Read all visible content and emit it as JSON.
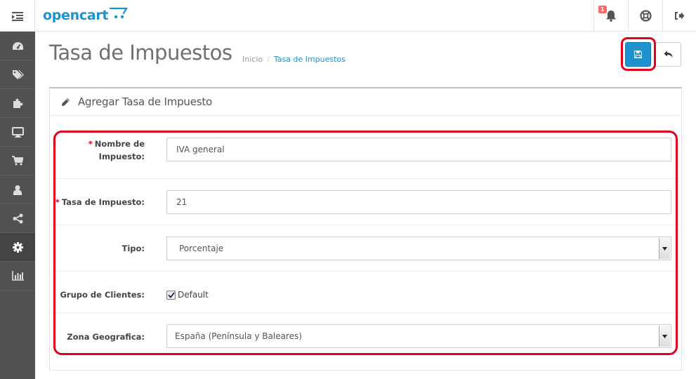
{
  "header": {
    "logo_text": "opencart",
    "notifications_count": "1"
  },
  "sidebar": {
    "items": [
      {
        "icon": "dashboard-icon"
      },
      {
        "icon": "tags-icon"
      },
      {
        "icon": "puzzle-icon"
      },
      {
        "icon": "desktop-icon"
      },
      {
        "icon": "shopping-cart-icon"
      },
      {
        "icon": "user-icon"
      },
      {
        "icon": "share-icon"
      },
      {
        "icon": "cog-icon",
        "active": true
      },
      {
        "icon": "bar-chart-icon"
      }
    ]
  },
  "page": {
    "title": "Tasa de Impuestos",
    "breadcrumb": [
      "Inicio",
      "Tasa de Impuestos"
    ],
    "breadcrumb_sep": "/"
  },
  "panel": {
    "title": "Agregar Tasa de Impuesto"
  },
  "form": {
    "name_label_line1": "Nombre de",
    "name_label_line2": "Impuesto:",
    "name_value": "IVA general",
    "rate_label": "Tasa de Impuesto:",
    "rate_value": "21",
    "type_label": "Tipo:",
    "type_value": "Porcentaje",
    "group_label": "Grupo de Clientes:",
    "group_option": "Default",
    "group_checked": true,
    "zone_label": "Zona Geografica:",
    "zone_value": "España (Península y Baleares)",
    "required_mark": "*"
  },
  "colors": {
    "primary": "#1e91cf",
    "sidebar": "#515151",
    "highlight": "#e3001b"
  }
}
